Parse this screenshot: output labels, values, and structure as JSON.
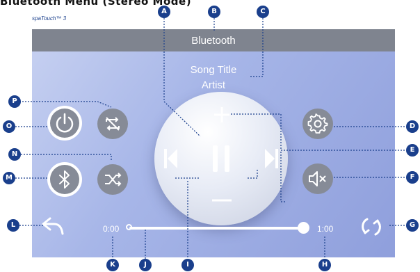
{
  "heading": "Bluetooth Menu (Stereo Mode)",
  "brand": "spaTouch™ 3",
  "topbar": {
    "title": "Bluetooth"
  },
  "track": {
    "title": "Song Title",
    "artist": "Artist",
    "elapsed": "0:00",
    "duration": "1:00",
    "progress": 1.0
  },
  "icons": {
    "power": "power-icon",
    "bluetooth": "bluetooth-icon",
    "repeat_off": "repeat-off-icon",
    "shuffle": "shuffle-icon",
    "volume_up": "plus-icon",
    "volume_down": "minus-icon",
    "previous": "skip-previous-icon",
    "pause": "pause-icon",
    "next": "skip-next-icon",
    "settings": "gear-icon",
    "mute": "mute-icon",
    "back": "back-arrow-icon",
    "refresh": "refresh-icon"
  },
  "callouts": [
    "A",
    "B",
    "C",
    "D",
    "E",
    "F",
    "G",
    "H",
    "I",
    "J",
    "K",
    "L",
    "M",
    "N",
    "O",
    "P"
  ],
  "colors": {
    "callout": "#1a3f8c",
    "screen_start": "#c7d1f1",
    "screen_end": "#8f9fdc",
    "topbar": "#7f848f",
    "button_grey": "#868b97"
  }
}
